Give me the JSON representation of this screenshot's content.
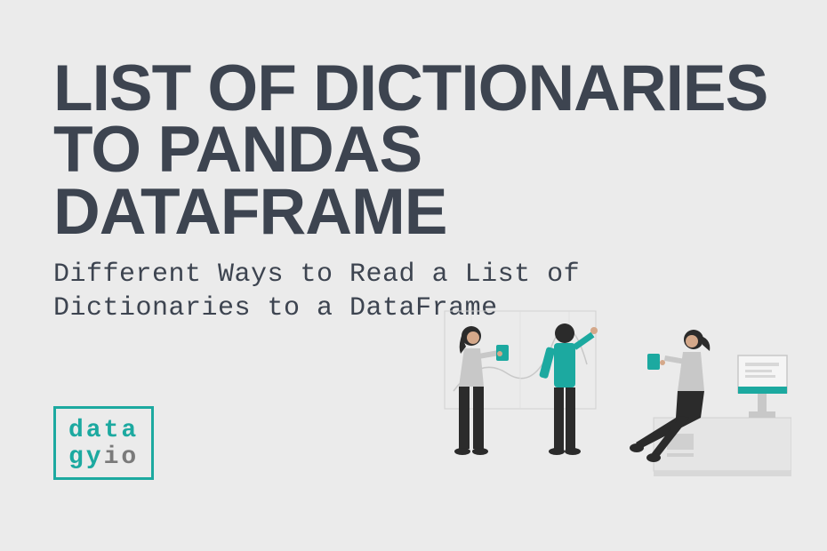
{
  "title_line1": "LIST OF DICTIONARIES",
  "title_line2": "TO PANDAS DATAFRAME",
  "subtitle": "Different Ways to Read a List of Dictionaries to a DataFrame",
  "logo": {
    "line1": "data",
    "line2_a": "gy",
    "line2_b": "io"
  },
  "colors": {
    "background": "#ebebeb",
    "text_dark": "#3d4450",
    "accent": "#1ca9a0",
    "grey": "#7a7a7a"
  }
}
